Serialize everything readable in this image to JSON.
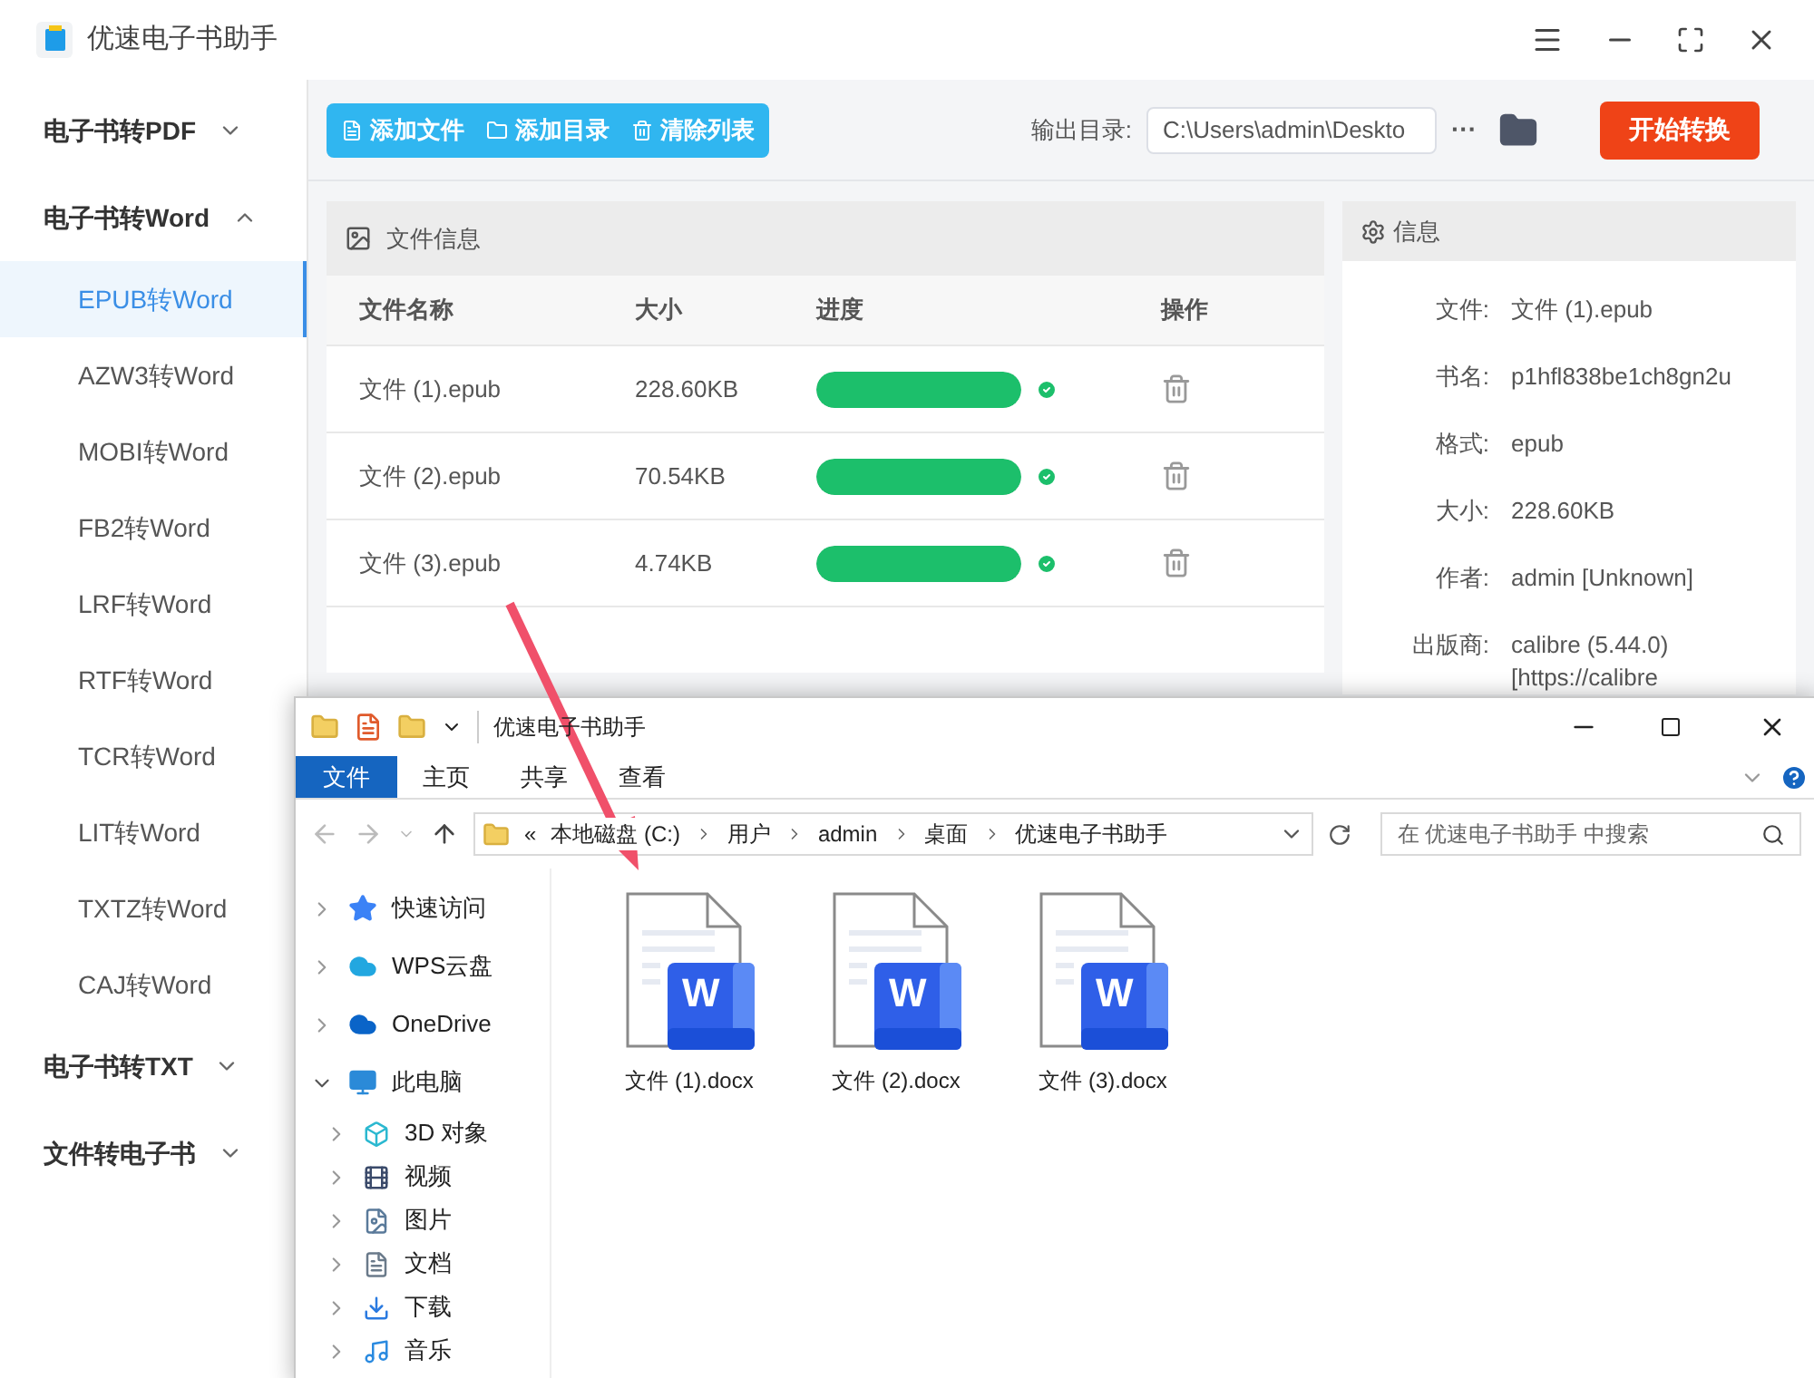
{
  "app": {
    "title": "优速电子书助手"
  },
  "sidebar": [
    {
      "label": "电子书转PDF",
      "expanded": false
    },
    {
      "label": "电子书转Word",
      "expanded": true,
      "children": [
        {
          "label": "EPUB转Word",
          "selected": true
        },
        {
          "label": "AZW3转Word",
          "selected": false
        },
        {
          "label": "MOBI转Word",
          "selected": false
        },
        {
          "label": "FB2转Word",
          "selected": false
        },
        {
          "label": "LRF转Word",
          "selected": false
        },
        {
          "label": "RTF转Word",
          "selected": false
        },
        {
          "label": "TCR转Word",
          "selected": false
        },
        {
          "label": "LIT转Word",
          "selected": false
        },
        {
          "label": "TXTZ转Word",
          "selected": false
        },
        {
          "label": "CAJ转Word",
          "selected": false
        }
      ]
    },
    {
      "label": "电子书转TXT",
      "expanded": false
    },
    {
      "label": "文件转电子书",
      "expanded": false
    }
  ],
  "toolbar": {
    "buttons": [
      "添加文件",
      "添加目录",
      "清除列表"
    ],
    "output_label": "输出目录:",
    "output_path": "C:\\Users\\admin\\Deskto",
    "more": "···",
    "start_button": "开始转换"
  },
  "file_panel": {
    "title": "文件信息",
    "columns": [
      "文件名称",
      "大小",
      "进度",
      "操作"
    ],
    "rows": [
      {
        "name": "文件 (1).epub",
        "size": "228.60KB",
        "level": 1
      },
      {
        "name": "文件 (2).epub",
        "size": "70.54KB",
        "level": 1
      },
      {
        "name": "文件 (3).epub",
        "size": "4.74KB",
        "level": 1
      }
    ]
  },
  "info_panel": {
    "title": "信息",
    "fields": [
      {
        "label": "文件:",
        "value": "文件 (1).epub"
      },
      {
        "label": "书名:",
        "value": "p1hfl838be1ch8gn2u"
      },
      {
        "label": "格式:",
        "value": "epub"
      },
      {
        "label": "大小:",
        "value": "228.60KB"
      },
      {
        "label": "作者:",
        "value": "admin [Unknown]"
      },
      {
        "label": "出版商:",
        "value": "calibre (5.44.0) [https://calibre"
      }
    ]
  },
  "explorer": {
    "title": "优速电子书助手",
    "ribbon_tabs": [
      {
        "label": "文件",
        "selected": true
      },
      {
        "label": "主页",
        "selected": false
      },
      {
        "label": "共享",
        "selected": false
      },
      {
        "label": "查看",
        "selected": false
      }
    ],
    "breadcrumb_prefix": "«",
    "breadcrumb": [
      "本地磁盘 (C:)",
      "用户",
      "admin",
      "桌面",
      "优速电子书助手"
    ],
    "search_placeholder": "在 优速电子书助手 中搜索",
    "nav": [
      {
        "label": "快速访问",
        "expanded": false
      },
      {
        "label": "WPS云盘",
        "expanded": false
      },
      {
        "label": "OneDrive",
        "expanded": false
      },
      {
        "label": "此电脑",
        "expanded": true,
        "children": [
          {
            "label": "3D 对象",
            "expanded": false
          },
          {
            "label": "视频",
            "expanded": false
          },
          {
            "label": "图片",
            "expanded": false
          },
          {
            "label": "文档",
            "expanded": false
          },
          {
            "label": "下载",
            "expanded": false
          },
          {
            "label": "音乐",
            "expanded": false
          }
        ]
      }
    ],
    "files": [
      {
        "name": "文件 (1).docx",
        "badge": "W"
      },
      {
        "name": "文件 (2).docx",
        "badge": "W"
      },
      {
        "name": "文件 (3).docx",
        "badge": "W"
      }
    ]
  }
}
